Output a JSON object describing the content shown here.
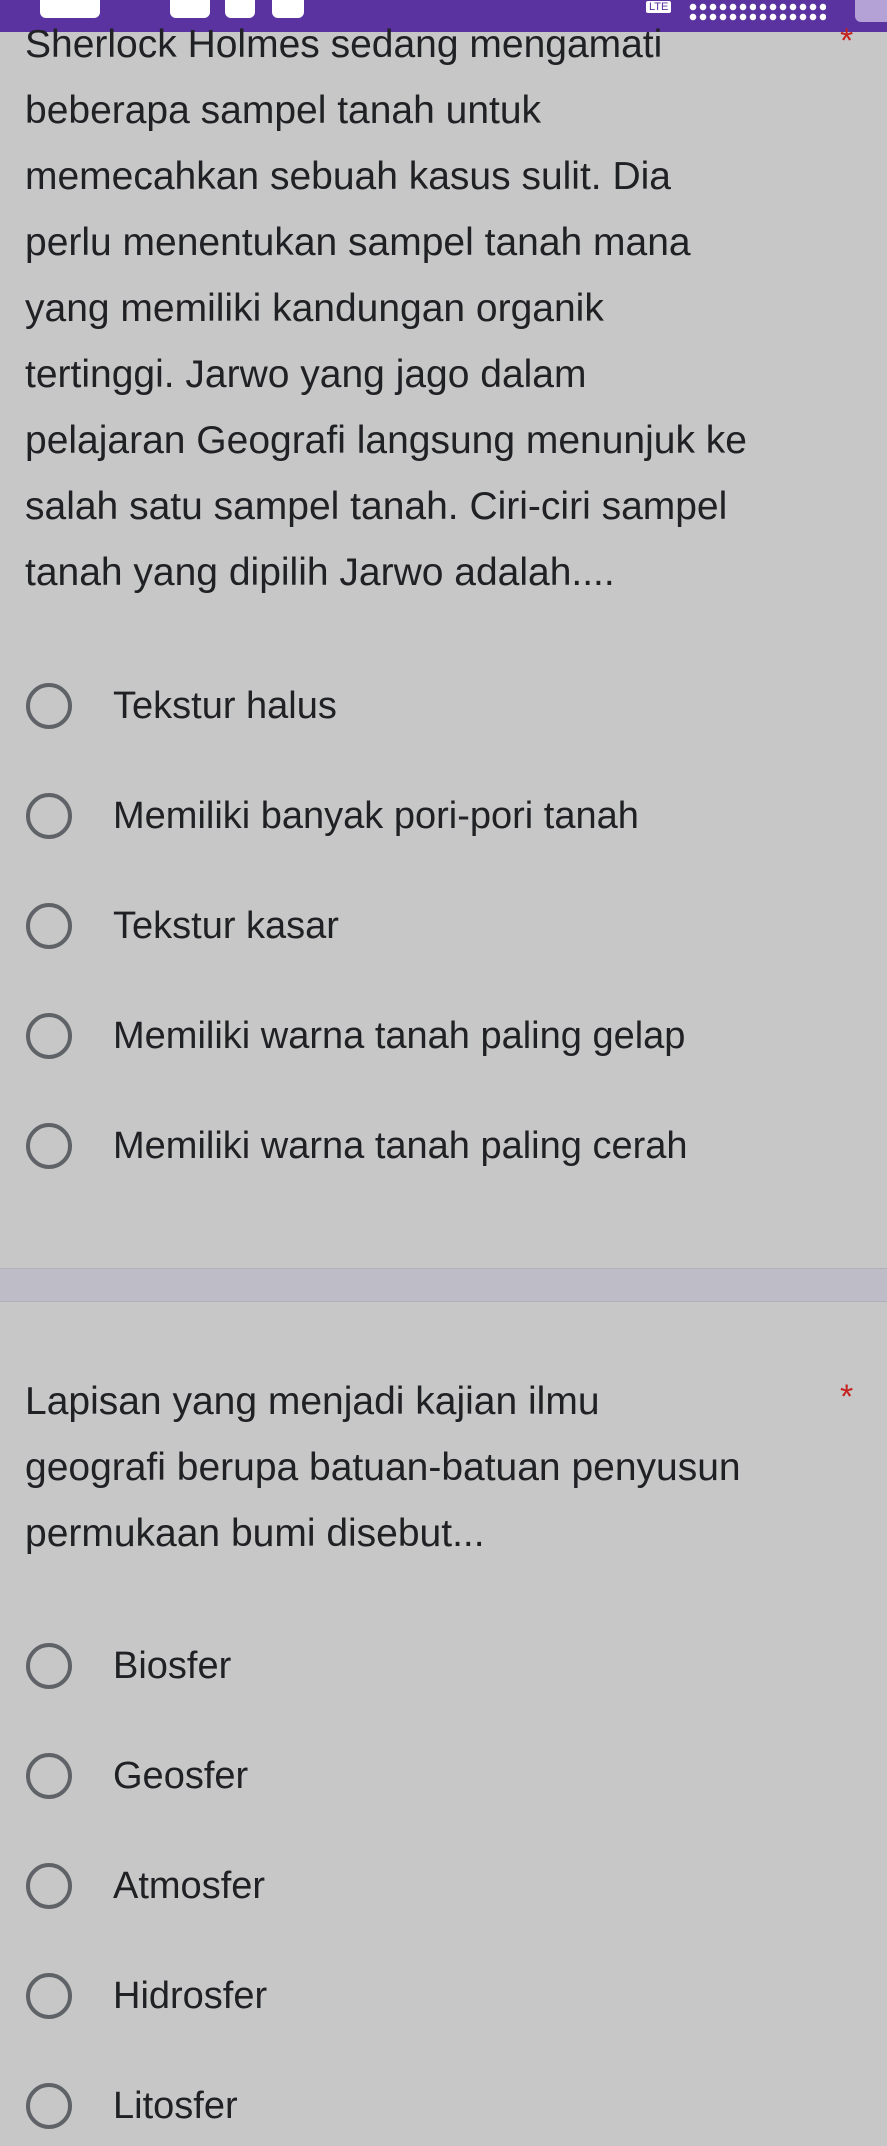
{
  "status_bar": {
    "network": "LTE"
  },
  "questions": [
    {
      "lines": [
        "Sherlock Holmes sedang mengamati",
        "beberapa sampel tanah untuk",
        "memecahkan sebuah kasus sulit. Dia",
        "perlu menentukan sampel tanah mana",
        "yang memiliki kandungan organik",
        "tertinggi. Jarwo yang jago dalam",
        "pelajaran Geografi langsung menunjuk ke",
        "salah satu sampel tanah. Ciri-ciri sampel",
        "tanah yang dipilih Jarwo adalah...."
      ],
      "required_mark": "*",
      "options": [
        "Tekstur halus",
        "Memiliki banyak pori-pori tanah",
        "Tekstur kasar",
        "Memiliki warna tanah paling gelap",
        "Memiliki warna tanah paling cerah"
      ]
    },
    {
      "lines": [
        "Lapisan yang menjadi kajian ilmu",
        "geografi berupa batuan-batuan penyusun",
        "permukaan bumi disebut..."
      ],
      "required_mark": "*",
      "options": [
        "Biosfer",
        "Geosfer",
        "Atmosfer",
        "Hidrosfer",
        "Litosfer"
      ]
    }
  ],
  "colors": {
    "status_bar": "#5b33a0",
    "background": "#c7c7c7",
    "required": "#c5221f",
    "radio_border": "#5f6368",
    "text": "#202124"
  },
  "icons": [
    "status-icon",
    "lte-badge",
    "signal-dots-icon",
    "battery-icon",
    "radio-unchecked-icon"
  ]
}
